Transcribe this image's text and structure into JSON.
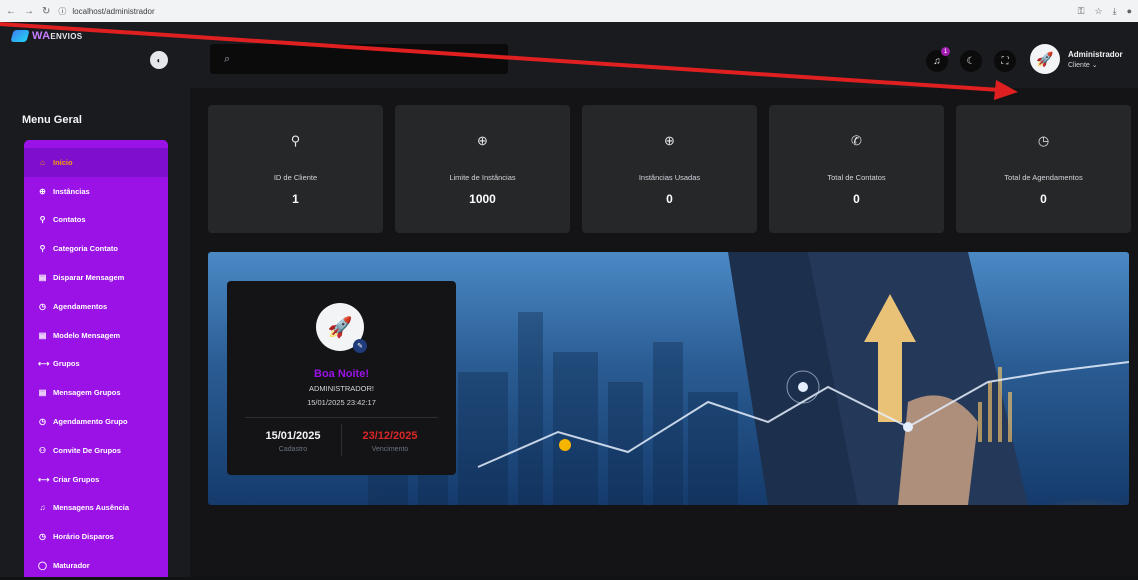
{
  "browser": {
    "url": "localhost/administrador"
  },
  "brand": {
    "logo_main": "WA",
    "logo_rest": "ENVIOS"
  },
  "header": {
    "search_placeholder": "",
    "notification_count": "1",
    "user_name": "Administrador",
    "user_role": "Cliente ⌄"
  },
  "sidebar": {
    "title": "Menu Geral",
    "items": [
      {
        "label": "Início",
        "icon": "home-icon",
        "glyph": "⌂"
      },
      {
        "label": "Instâncias",
        "icon": "globe-icon",
        "glyph": "⊕"
      },
      {
        "label": "Contatos",
        "icon": "user-icon",
        "glyph": "⚲"
      },
      {
        "label": "Categoria Contato",
        "icon": "user-icon",
        "glyph": "⚲"
      },
      {
        "label": "Disparar Mensagem",
        "icon": "document-icon",
        "glyph": "▤"
      },
      {
        "label": "Agendamentos",
        "icon": "clock-icon",
        "glyph": "◷"
      },
      {
        "label": "Modelo Mensagem",
        "icon": "document-icon",
        "glyph": "▤"
      },
      {
        "label": "Grupos",
        "icon": "group-icon",
        "glyph": "⟷"
      },
      {
        "label": "Mensagem Grupos",
        "icon": "document-icon",
        "glyph": "▤"
      },
      {
        "label": "Agendamento Grupo",
        "icon": "clock-icon",
        "glyph": "◷"
      },
      {
        "label": "Convite De Grupos",
        "icon": "users-icon",
        "glyph": "⚇"
      },
      {
        "label": "Criar Grupos",
        "icon": "group-icon",
        "glyph": "⟷"
      },
      {
        "label": "Mensagens Ausência",
        "icon": "bell-icon",
        "glyph": "♫"
      },
      {
        "label": "Horário Disparos",
        "icon": "clock-icon",
        "glyph": "◷"
      },
      {
        "label": "Maturador",
        "icon": "chat-icon",
        "glyph": "◯"
      }
    ]
  },
  "stats": [
    {
      "label": "ID de Cliente",
      "value": "1",
      "icon": "user-icon",
      "glyph": "⚲"
    },
    {
      "label": "Limite de Instâncias",
      "value": "1000",
      "icon": "globe-icon",
      "glyph": "⊕"
    },
    {
      "label": "Instâncias Usadas",
      "value": "0",
      "icon": "globe-icon",
      "glyph": "⊕"
    },
    {
      "label": "Total de Contatos",
      "value": "0",
      "icon": "phone-icon",
      "glyph": "✆"
    },
    {
      "label": "Total de Agendamentos",
      "value": "0",
      "icon": "clock-icon",
      "glyph": "◷"
    }
  ],
  "profile": {
    "greeting": "Boa Noite!",
    "name": "ADMINISTRADOR!",
    "datetime": "15/01/2025 23:42:17",
    "signup_date": "15/01/2025",
    "signup_label": "Cadastro",
    "expiry_date": "23/12/2025",
    "expiry_label": "Vencimento"
  },
  "colors": {
    "accent": "#9a12e6",
    "active_text": "#f59e0b",
    "expiry": "#dc2626",
    "annotation_arrow": "#e02020"
  }
}
